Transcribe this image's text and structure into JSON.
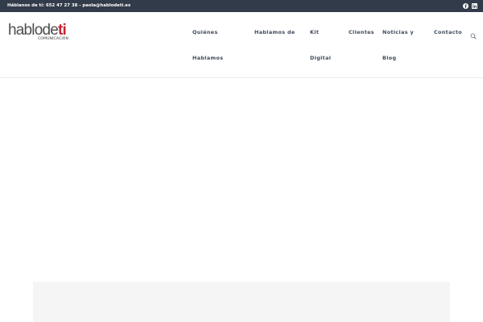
{
  "topbar": {
    "contact_text": "Háblanos de tí: 652 47 27 38 - paola@hablodeti.es",
    "social": [
      {
        "icon": "facebook-icon"
      },
      {
        "icon": "linkedin-icon"
      }
    ]
  },
  "logo": {
    "part1": "hablode",
    "part2": "ti",
    "sub": "COMUNICACIÓN"
  },
  "nav": {
    "items": [
      {
        "line1": "Quiénes",
        "line2": "Hablamos"
      },
      {
        "line1": "Hablamos de",
        "line2": ""
      },
      {
        "line1": "Kit",
        "line2": "Digital"
      },
      {
        "line1": "Clientes",
        "line2": ""
      },
      {
        "line1": "Noticias y",
        "line2": "Blog"
      },
      {
        "line1": "Contacto",
        "line2": ""
      }
    ],
    "search_icon": "search-icon"
  },
  "colors": {
    "topbar_bg": "#323b49",
    "brand_red": "#c9232f",
    "nav_text": "#3f4a5a",
    "content_box_bg": "#f5f5f5"
  }
}
